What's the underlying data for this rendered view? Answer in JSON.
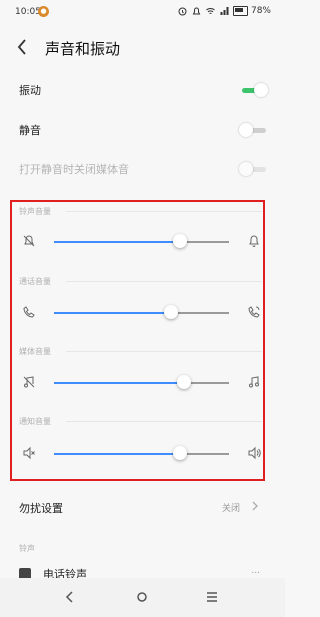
{
  "status": {
    "time": "10:05",
    "battery": "78%"
  },
  "header": {
    "title": "声音和振动"
  },
  "settings": {
    "vibrate_label": "振动",
    "vibrate_on": true,
    "mute_label": "静音",
    "mute_on": false,
    "silent_media_label": "打开静音时关闭媒体音",
    "silent_media_on": false
  },
  "volumes": [
    {
      "label": "铃声音量",
      "level": 0.72,
      "left_icon": "ringer-off-icon",
      "right_icon": "ringer-icon"
    },
    {
      "label": "通话音量",
      "level": 0.67,
      "left_icon": "phone-icon",
      "right_icon": "phone-volume-icon"
    },
    {
      "label": "媒体音量",
      "level": 0.74,
      "left_icon": "music-off-icon",
      "right_icon": "music-icon"
    },
    {
      "label": "通知音量",
      "level": 0.72,
      "left_icon": "speaker-mute-icon",
      "right_icon": "speaker-icon"
    }
  ],
  "dnd": {
    "label": "勿扰设置",
    "value": "关闭"
  },
  "ringtone_section": {
    "label": "铃声"
  },
  "ringtone_row": {
    "label": "电话铃声",
    "value": "..."
  },
  "colors": {
    "accent": "#3f8cff",
    "toggle_on": "#3cc36b",
    "highlight_box": "#e02020"
  }
}
